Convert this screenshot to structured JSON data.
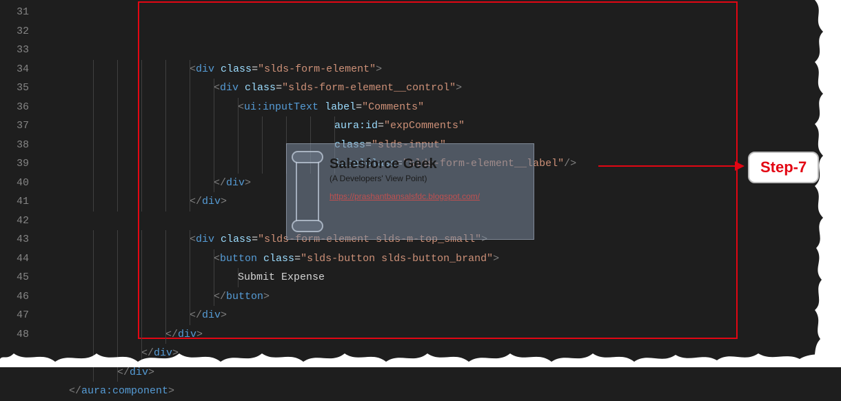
{
  "badge": {
    "label": "Step-7"
  },
  "watermark": {
    "title": "Salesforce Geek",
    "subtitle": "(A Developers' View Point)",
    "url": "https://prashantbansalsfdc.blogspot.com/"
  },
  "gutter": {
    "start": 31,
    "end": 48
  },
  "code": {
    "lines": [
      {
        "n": 31,
        "indent": 5,
        "tokens": [
          [
            "punc",
            "<"
          ],
          [
            "tag",
            "div"
          ],
          [
            "text",
            " "
          ],
          [
            "attr",
            "class"
          ],
          [
            "eq",
            "="
          ],
          [
            "str",
            "\"slds-form-element\""
          ],
          [
            "punc",
            ">"
          ]
        ]
      },
      {
        "n": 32,
        "indent": 6,
        "tokens": [
          [
            "punc",
            "<"
          ],
          [
            "tag",
            "div"
          ],
          [
            "text",
            " "
          ],
          [
            "attr",
            "class"
          ],
          [
            "eq",
            "="
          ],
          [
            "str",
            "\"slds-form-element__control\""
          ],
          [
            "punc",
            ">"
          ]
        ]
      },
      {
        "n": 33,
        "indent": 7,
        "tokens": [
          [
            "punc",
            "<"
          ],
          [
            "tag",
            "ui:inputText"
          ],
          [
            "text",
            " "
          ],
          [
            "attr",
            "label"
          ],
          [
            "eq",
            "="
          ],
          [
            "str",
            "\"Comments\""
          ]
        ]
      },
      {
        "n": 34,
        "indent": 11,
        "tokens": [
          [
            "attr",
            "aura:id"
          ],
          [
            "eq",
            "="
          ],
          [
            "str",
            "\"expComments\""
          ]
        ]
      },
      {
        "n": 35,
        "indent": 11,
        "tokens": [
          [
            "attr",
            "class"
          ],
          [
            "eq",
            "="
          ],
          [
            "str",
            "\"slds-input\""
          ]
        ]
      },
      {
        "n": 36,
        "indent": 11,
        "tokens": [
          [
            "attr",
            "labelClass"
          ],
          [
            "eq",
            "="
          ],
          [
            "str",
            "\"slds-form-element__label\""
          ],
          [
            "punc",
            "/>"
          ]
        ]
      },
      {
        "n": 37,
        "indent": 6,
        "tokens": [
          [
            "punc",
            "</"
          ],
          [
            "tag",
            "div"
          ],
          [
            "punc",
            ">"
          ]
        ]
      },
      {
        "n": 38,
        "indent": 5,
        "tokens": [
          [
            "punc",
            "</"
          ],
          [
            "tag",
            "div"
          ],
          [
            "punc",
            ">"
          ]
        ]
      },
      {
        "n": 39,
        "indent": 0,
        "tokens": []
      },
      {
        "n": 40,
        "indent": 5,
        "tokens": [
          [
            "punc",
            "<"
          ],
          [
            "tag",
            "div"
          ],
          [
            "text",
            " "
          ],
          [
            "attr",
            "class"
          ],
          [
            "eq",
            "="
          ],
          [
            "str",
            "\"slds-form-element slds-m-top_small\""
          ],
          [
            "punc",
            ">"
          ]
        ]
      },
      {
        "n": 41,
        "indent": 6,
        "tokens": [
          [
            "punc",
            "<"
          ],
          [
            "tag",
            "button"
          ],
          [
            "text",
            " "
          ],
          [
            "attr",
            "class"
          ],
          [
            "eq",
            "="
          ],
          [
            "str",
            "\"slds-button slds-button_brand\""
          ],
          [
            "punc",
            ">"
          ]
        ]
      },
      {
        "n": 42,
        "indent": 7,
        "tokens": [
          [
            "text",
            "Submit Expense"
          ]
        ]
      },
      {
        "n": 43,
        "indent": 6,
        "tokens": [
          [
            "punc",
            "</"
          ],
          [
            "tag",
            "button"
          ],
          [
            "punc",
            ">"
          ]
        ]
      },
      {
        "n": 44,
        "indent": 5,
        "tokens": [
          [
            "punc",
            "</"
          ],
          [
            "tag",
            "div"
          ],
          [
            "punc",
            ">"
          ]
        ]
      },
      {
        "n": 45,
        "indent": 4,
        "tokens": [
          [
            "punc",
            "</"
          ],
          [
            "tag",
            "div"
          ],
          [
            "punc",
            ">"
          ]
        ]
      },
      {
        "n": 46,
        "indent": 3,
        "tokens": [
          [
            "punc",
            "</"
          ],
          [
            "tag",
            "div"
          ],
          [
            "punc",
            ">"
          ]
        ]
      },
      {
        "n": 47,
        "indent": 2,
        "tokens": [
          [
            "punc",
            "</"
          ],
          [
            "tag",
            "div"
          ],
          [
            "punc",
            ">"
          ]
        ]
      },
      {
        "n": 48,
        "indent": 0,
        "tokens": [
          [
            "punc",
            "</"
          ],
          [
            "tag",
            "aura:component"
          ],
          [
            "punc",
            ">"
          ]
        ]
      }
    ]
  }
}
